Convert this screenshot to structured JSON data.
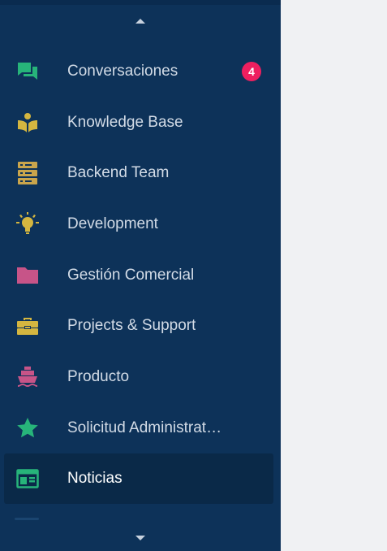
{
  "sidebar": {
    "scroll_up_icon": "chevron-up-icon",
    "scroll_down_icon": "chevron-down-icon",
    "items": [
      {
        "label": "Conversaciones",
        "icon": "chat-bubbles-icon",
        "color": "#27b47a",
        "badge": "4"
      },
      {
        "label": "Knowledge Base",
        "icon": "book-reader-icon",
        "color": "#d4b640"
      },
      {
        "label": "Backend Team",
        "icon": "server-rack-icon",
        "color": "#c9a54c"
      },
      {
        "label": "Development",
        "icon": "lightbulb-icon",
        "color": "#d4b640"
      },
      {
        "label": "Gestión Comercial",
        "icon": "folder-icon",
        "color": "#c75488"
      },
      {
        "label": "Projects & Support",
        "icon": "toolbox-icon",
        "color": "#d4b640"
      },
      {
        "label": "Producto",
        "icon": "ship-icon",
        "color": "#c75488"
      },
      {
        "label": "Solicitud Administrat…",
        "icon": "star-icon",
        "color": "#27b47a"
      },
      {
        "label": "Noticias",
        "icon": "newspaper-icon",
        "color": "#27b47a",
        "active": true
      }
    ]
  },
  "colors": {
    "sidebar_bg": "#0d3259",
    "active_bg": "#0a2948",
    "badge_bg": "#ee1f5f",
    "content_bg": "#f0f1f3"
  }
}
